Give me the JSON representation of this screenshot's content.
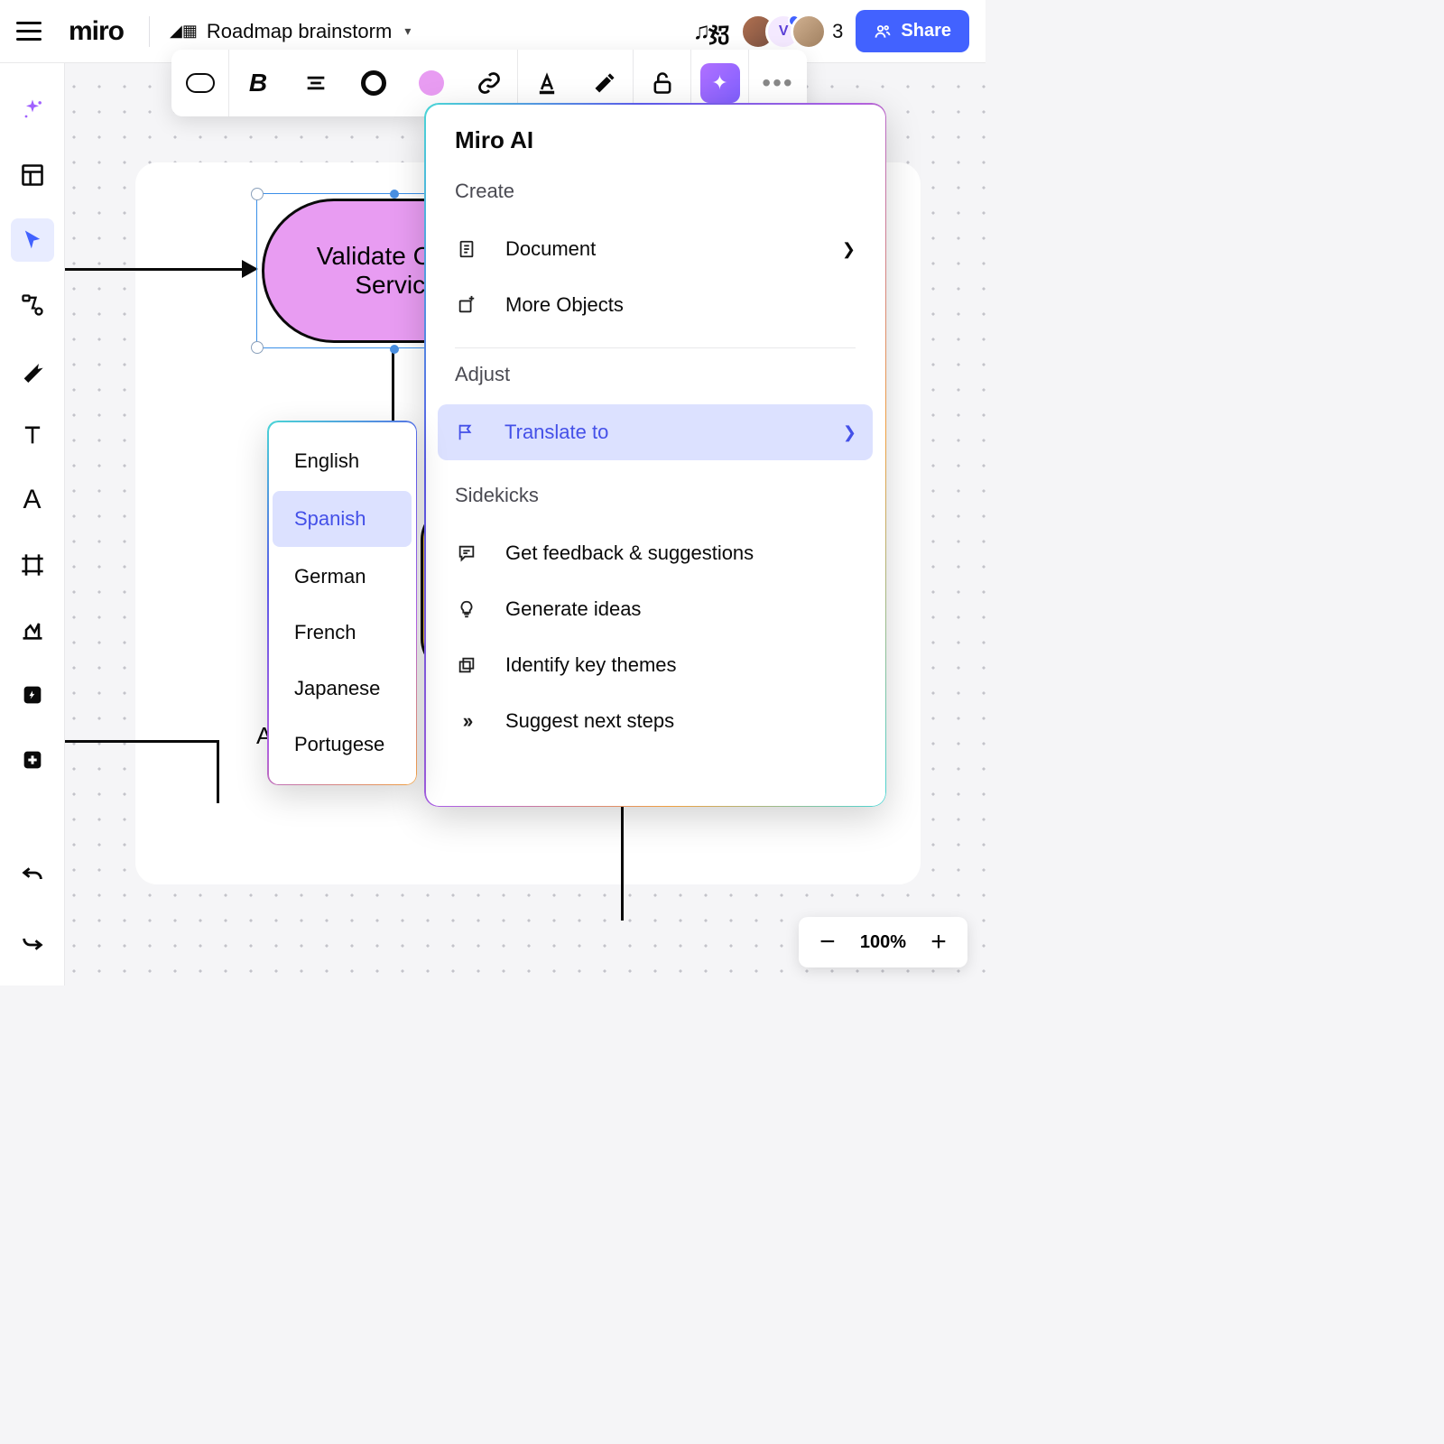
{
  "header": {
    "board_title": "Roadmap brainstorm",
    "collaborator_initial": "V",
    "collaborator_count": "3",
    "share_label": "Share"
  },
  "context_toolbar": {
    "fill_color": "#e89cf2"
  },
  "shape": {
    "label": "Validate Client Service"
  },
  "canvas": {
    "stray_label": "A"
  },
  "ai_panel": {
    "title": "Miro AI",
    "sections": {
      "create": "Create",
      "adjust": "Adjust",
      "sidekicks": "Sidekicks"
    },
    "items": {
      "document": "Document",
      "more_objects": "More Objects",
      "translate": "Translate to",
      "feedback": "Get feedback & suggestions",
      "ideas": "Generate ideas",
      "themes": "Identify key themes",
      "next_steps": "Suggest next steps"
    }
  },
  "languages": {
    "english": "English",
    "spanish": "Spanish",
    "german": "German",
    "french": "French",
    "japanese": "Japanese",
    "portugese": "Portugese"
  },
  "zoom": {
    "percent": "100%"
  }
}
